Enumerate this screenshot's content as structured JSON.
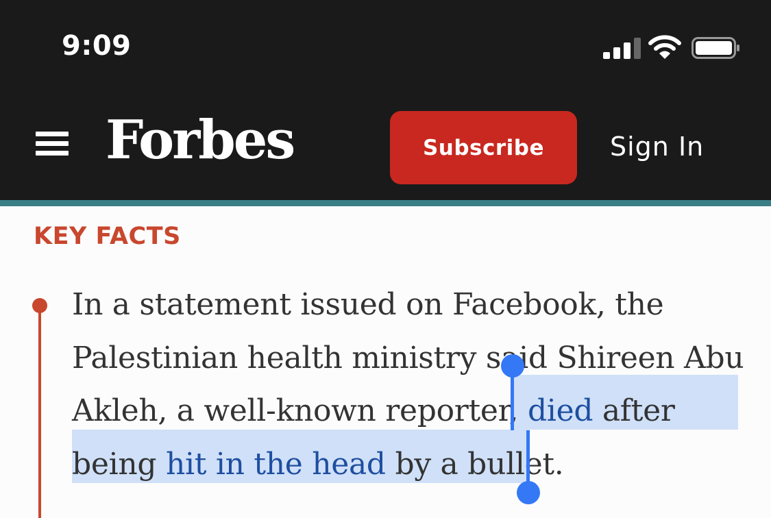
{
  "status_bar": {
    "time": "9:09",
    "icons": [
      "signal-icon",
      "wifi-icon",
      "battery-icon"
    ]
  },
  "header": {
    "menu_icon": "hamburger-menu-icon",
    "logo": "Forbes",
    "subscribe_label": "Subscribe",
    "sign_in_label": "Sign In"
  },
  "section": {
    "label": "KEY FACTS"
  },
  "article": {
    "line1": "In a statement issued on Facebook, the",
    "line2": "Palestinian health ministry said Shireen Abu",
    "line3_before": "Akleh, a well-known reporter, ",
    "line3_link": "died",
    "line3_after": " after",
    "line4_before": "being ",
    "line4_link": "hit in the head",
    "line4_after": " by a bullet."
  },
  "colors": {
    "header_bg": "#1a1a1a",
    "accent_teal": "#3a7f86",
    "subscribe_red": "#c8281f",
    "key_facts_red": "#c8472e",
    "link_blue": "#1e4ea0",
    "selection_bg": "#cfe0f8",
    "selection_handle": "#3478f6"
  }
}
